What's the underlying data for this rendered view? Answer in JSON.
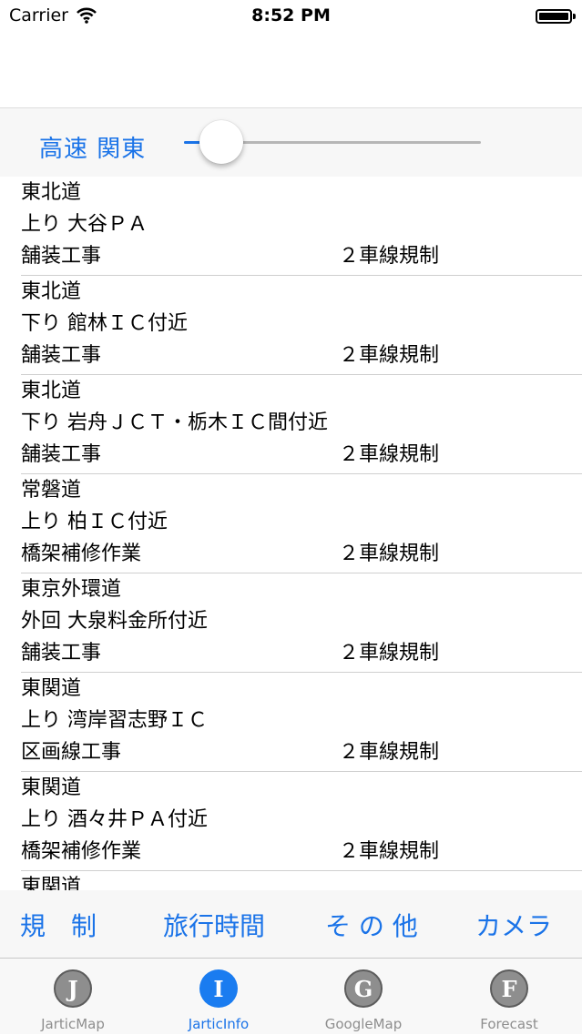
{
  "status_bar": {
    "carrier": "Carrier",
    "time": "8:52 PM"
  },
  "slider": {
    "label": "高速 関東",
    "value": 0.09
  },
  "restrictions": [
    {
      "road": "東北道",
      "location": "上り 大谷ＰＡ",
      "work": "舗装工事",
      "restriction": "２車線規制"
    },
    {
      "road": "東北道",
      "location": "下り 館林ＩＣ付近",
      "work": "舗装工事",
      "restriction": "２車線規制"
    },
    {
      "road": "東北道",
      "location": "下り 岩舟ＪＣＴ・栃木ＩＣ間付近",
      "work": "舗装工事",
      "restriction": "２車線規制"
    },
    {
      "road": "常磐道",
      "location": "上り 柏ＩＣ付近",
      "work": "橋架補修作業",
      "restriction": "２車線規制"
    },
    {
      "road": "東京外環道",
      "location": "外回 大泉料金所付近",
      "work": "舗装工事",
      "restriction": "２車線規制"
    },
    {
      "road": "東関道",
      "location": "上り 湾岸習志野ＩＣ",
      "work": "区画線工事",
      "restriction": "２車線規制"
    },
    {
      "road": "東関道",
      "location": "上り 酒々井ＰＡ付近",
      "work": "橋架補修作業",
      "restriction": "２車線規制"
    },
    {
      "road": "東関道",
      "location": "",
      "work": "",
      "restriction": ""
    }
  ],
  "segments": [
    "規　制",
    "旅行時間",
    "そ の 他",
    "カメラ"
  ],
  "tabs": [
    {
      "letter": "J",
      "label": "JarticMap",
      "active": false
    },
    {
      "letter": "I",
      "label": "JarticInfo",
      "active": true
    },
    {
      "letter": "G",
      "label": "GoogleMap",
      "active": false
    },
    {
      "letter": "F",
      "label": "Forecast",
      "active": false
    }
  ],
  "colors": {
    "accent": "#1a73e8",
    "inactive": "#8e8e8e"
  }
}
